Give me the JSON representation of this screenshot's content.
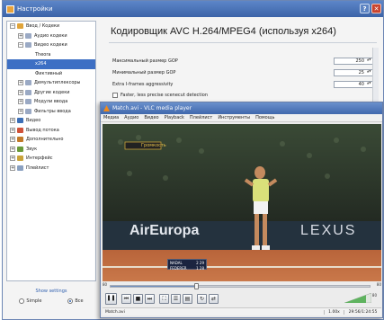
{
  "prefs": {
    "window_title": "Настройки",
    "help_glyph": "?",
    "close_glyph": "✕",
    "panel_title": "Кодировщик AVC H.264/MPEG4 (используя x264)",
    "tree": [
      {
        "label": "Ввод / Кодеки",
        "exp": "−",
        "level": 0,
        "icon": "#e0a43a"
      },
      {
        "label": "Аудио кодеки",
        "exp": "+",
        "level": 1,
        "icon": "#9aa9c4"
      },
      {
        "label": "Видео кодеки",
        "exp": "−",
        "level": 1,
        "icon": "#9aa9c4"
      },
      {
        "label": "Theora",
        "exp": "",
        "level": 2,
        "icon": ""
      },
      {
        "label": "x264",
        "exp": "",
        "level": 2,
        "icon": "",
        "selected": true
      },
      {
        "label": "Фиктивный",
        "exp": "",
        "level": 2,
        "icon": ""
      },
      {
        "label": "Демультиплексоры",
        "exp": "+",
        "level": 1,
        "icon": "#9aa9c4"
      },
      {
        "label": "Другие кодеки",
        "exp": "+",
        "level": 1,
        "icon": "#9aa9c4"
      },
      {
        "label": "Модули ввода",
        "exp": "+",
        "level": 1,
        "icon": "#9aa9c4"
      },
      {
        "label": "Фильтры ввода",
        "exp": "+",
        "level": 1,
        "icon": "#9aa9c4"
      },
      {
        "label": "Видео",
        "exp": "+",
        "level": 0,
        "icon": "#3d6fb6"
      },
      {
        "label": "Вывод потока",
        "exp": "+",
        "level": 0,
        "icon": "#d0523a"
      },
      {
        "label": "Дополнительно",
        "exp": "+",
        "level": 0,
        "icon": "#c27a2a"
      },
      {
        "label": "Звук",
        "exp": "+",
        "level": 0,
        "icon": "#6a9a3a"
      },
      {
        "label": "Интерфейс",
        "exp": "+",
        "level": 0,
        "icon": "#c9a33a"
      },
      {
        "label": "Плейлист",
        "exp": "+",
        "level": 0,
        "icon": "#8aa0c0"
      }
    ],
    "show_settings": "Show settings",
    "radio_simple": "Simple",
    "radio_all": "Все",
    "options": [
      {
        "label": "Максимальный размер GOP",
        "value": "250"
      },
      {
        "label": "Минимальный размер GOP",
        "value": "25"
      },
      {
        "label": "Extra I-frames aggressivity",
        "value": "40"
      }
    ],
    "checkbox_label": "Faster, less precise scenecut detection"
  },
  "vlc": {
    "title": "Match.avi - VLC media player",
    "menu": [
      "Медиа",
      "Аудио",
      "Видео",
      "Playback",
      "Плейлист",
      "Инструменты",
      "Помощь"
    ],
    "seek_left": "80",
    "seek_right": "80",
    "seek_progress": 0.33,
    "volume_percent": "80",
    "volume_level": 0.8,
    "status_file": "Match.avi",
    "status_speed": "1.00x",
    "status_time": "29:56/1:24:55",
    "scoreboard": {
      "p1": "NADAL",
      "p2": "FEDERER",
      "s1": "2 29",
      "s2": "1 28"
    },
    "banner": "AirEuropa",
    "banner2": "LEXUS",
    "osd_label": "Громкость",
    "controls": [
      {
        "name": "pause-button",
        "glyph": "❚❚"
      },
      {
        "name": "prev-button",
        "glyph": "⏮"
      },
      {
        "name": "stop-button",
        "glyph": "■"
      },
      {
        "name": "next-button",
        "glyph": "⏭"
      },
      {
        "name": "fullscreen-button",
        "glyph": "⛶"
      },
      {
        "name": "extended-settings-button",
        "glyph": "☰"
      },
      {
        "name": "playlist-button",
        "glyph": "▤"
      },
      {
        "name": "loop-button",
        "glyph": "↻"
      },
      {
        "name": "random-button",
        "glyph": "⇄"
      }
    ]
  }
}
